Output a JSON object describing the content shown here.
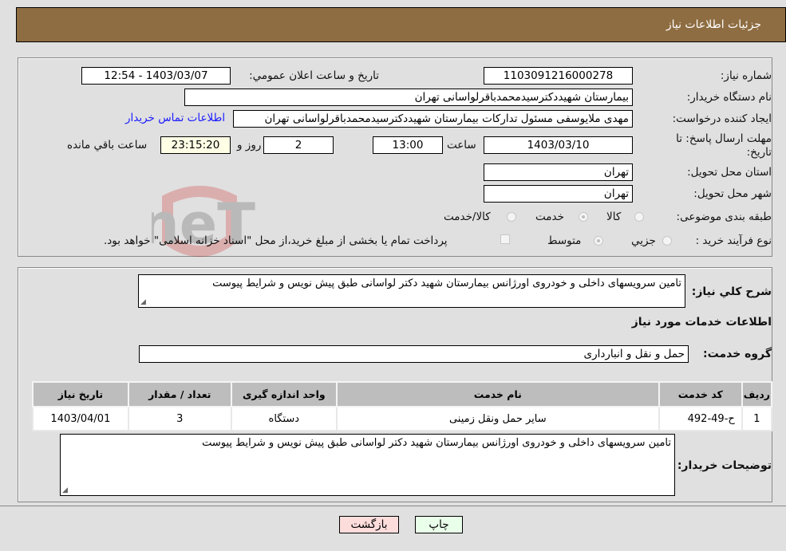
{
  "header": {
    "title": "جزئیات اطلاعات نیاز"
  },
  "fields": {
    "need_number": {
      "label": "شماره نیاز:",
      "value": "1103091216000278"
    },
    "announce_datetime": {
      "label": "تاريخ و ساعت اعلان عمومي:",
      "value": "1403/03/07 - 12:54"
    },
    "buyer_org": {
      "label": "نام دستگاه خریدار:",
      "value": "بیمارستان شهیددکترسیدمحمدباقرلواسانی تهران"
    },
    "requester": {
      "label": "ایجاد کننده درخواست:",
      "value": "مهدی ملایوسفی مسئول تدارکات بیمارستان شهیددکترسیدمحمدباقرلواسانی تهران",
      "contact_link": "اطلاعات تماس خریدار"
    },
    "deadline": {
      "label": "مهلت ارسال پاسخ: تا تاریخ:",
      "date": "1403/03/10",
      "time_label": "ساعت",
      "time": "13:00",
      "days": "2",
      "days_label": "روز و",
      "remaining": "23:15:20",
      "remaining_label": "ساعت باقي مانده"
    },
    "province": {
      "label": "استان محل تحویل:",
      "value": "تهران"
    },
    "city": {
      "label": "شهر محل تحویل:",
      "value": "تهران"
    },
    "category": {
      "label": "طبقه بندی موضوعی:",
      "options": [
        "کالا",
        "خدمت",
        "کالا/خدمت"
      ],
      "selected": "خدمت"
    },
    "purchase_type": {
      "label": "نوع فرآیند خرید :",
      "options": [
        "جزيي",
        "متوسط"
      ],
      "selected": "متوسط",
      "treasury_checkbox_label": "پرداخت تمام یا بخشی از مبلغ خرید،از محل \"اسناد خزانه اسلامی\" خواهد بود."
    }
  },
  "summary": {
    "label": "شرح کلي نياز:",
    "value": "تامین سرویسهای داخلی و خودروی اورژانس بیمارستان شهید دکتر لواسانی طبق پیش نویس و شرایط پیوست"
  },
  "services_section": {
    "title": "اطلاعات خدمات مورد نیاز",
    "group_label": "گروه خدمت:",
    "group_value": "حمل و نقل و انبارداری"
  },
  "table": {
    "columns": [
      "ردیف",
      "کد خدمت",
      "نام خدمت",
      "واحد اندازه گیری",
      "تعداد / مقدار",
      "تاریخ نیاز"
    ],
    "rows": [
      [
        "1",
        "ح-49-492",
        "سایر حمل ونقل زمینی",
        "دستگاه",
        "3",
        "1403/04/01"
      ]
    ]
  },
  "buyer_notes": {
    "label": "توضیحات خریدار:",
    "value": "تامین سرویسهای داخلی و خودروی اورژانس بیمارستان شهید دکتر لواسانی طبق پیش نویس و شرایط پیوست"
  },
  "buttons": {
    "print": "چاپ",
    "back": "بازگشت"
  },
  "watermark": {
    "text": "AriaTender.neT"
  },
  "colors": {
    "header_bg": "#8e6d42",
    "back_bg": "#fddcdc",
    "print_bg": "#eaffea",
    "link": "#1a1aff"
  }
}
